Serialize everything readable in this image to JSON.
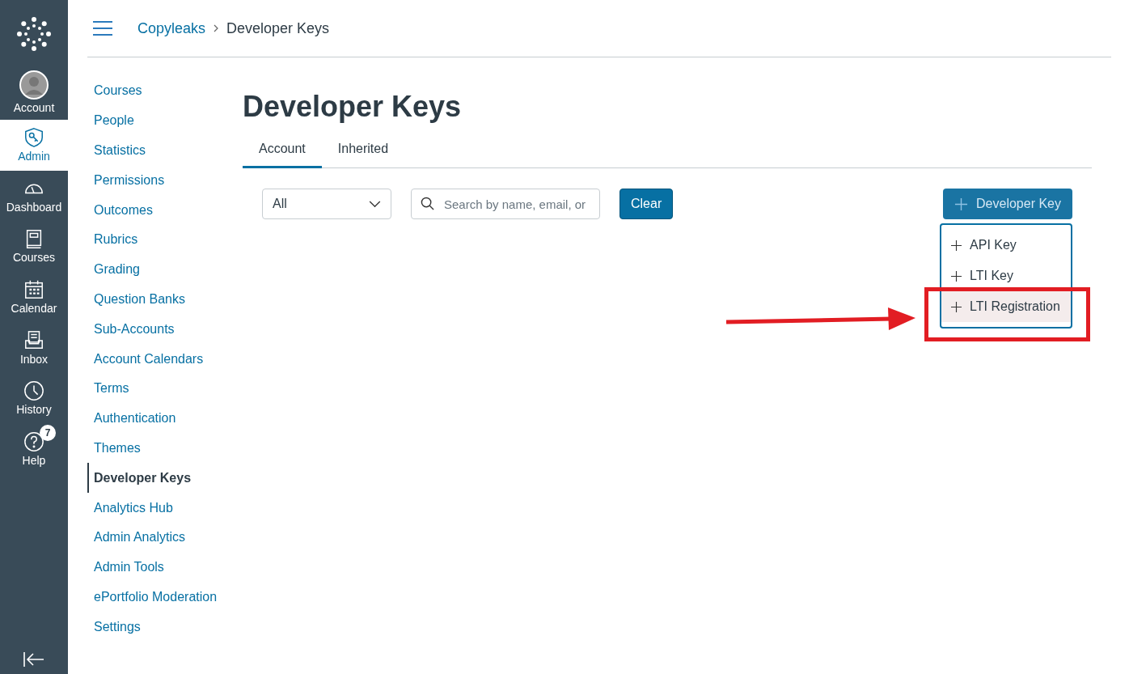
{
  "global_nav": [
    {
      "label": "Account",
      "kind": "avatar",
      "selected": false
    },
    {
      "label": "Admin",
      "kind": "admin",
      "selected": true
    },
    {
      "label": "Dashboard",
      "kind": "dashboard",
      "selected": false
    },
    {
      "label": "Courses",
      "kind": "courses",
      "selected": false
    },
    {
      "label": "Calendar",
      "kind": "calendar",
      "selected": false
    },
    {
      "label": "Inbox",
      "kind": "inbox",
      "selected": false
    },
    {
      "label": "History",
      "kind": "history",
      "selected": false
    },
    {
      "label": "Help",
      "kind": "help",
      "selected": false,
      "badge": "7"
    }
  ],
  "breadcrumb": [
    "Copyleaks",
    "Developer Keys"
  ],
  "course_nav": [
    {
      "label": "Courses",
      "selected": false
    },
    {
      "label": "People",
      "selected": false
    },
    {
      "label": "Statistics",
      "selected": false
    },
    {
      "label": "Permissions",
      "selected": false
    },
    {
      "label": "Outcomes",
      "selected": false
    },
    {
      "label": "Rubrics",
      "selected": false
    },
    {
      "label": "Grading",
      "selected": false
    },
    {
      "label": "Question Banks",
      "selected": false
    },
    {
      "label": "Sub-Accounts",
      "selected": false
    },
    {
      "label": "Account Calendars",
      "selected": false
    },
    {
      "label": "Terms",
      "selected": false
    },
    {
      "label": "Authentication",
      "selected": false
    },
    {
      "label": "Themes",
      "selected": false
    },
    {
      "label": "Developer Keys",
      "selected": true
    },
    {
      "label": "Analytics Hub",
      "selected": false
    },
    {
      "label": "Admin Analytics",
      "selected": false
    },
    {
      "label": "Admin Tools",
      "selected": false
    },
    {
      "label": "ePortfolio Moderation",
      "selected": false
    },
    {
      "label": "Settings",
      "selected": false
    }
  ],
  "page_title": "Developer Keys",
  "tabs": [
    {
      "label": "Account",
      "selected": true
    },
    {
      "label": "Inherited",
      "selected": false
    }
  ],
  "filter": {
    "value": "All"
  },
  "search": {
    "placeholder": "Search by name, email, or"
  },
  "clear_button": "Clear",
  "add_button": "Developer Key",
  "add_menu": [
    {
      "label": "API Key",
      "selected": false
    },
    {
      "label": "LTI Key",
      "selected": false
    },
    {
      "label": "LTI Registration",
      "selected": true
    }
  ]
}
